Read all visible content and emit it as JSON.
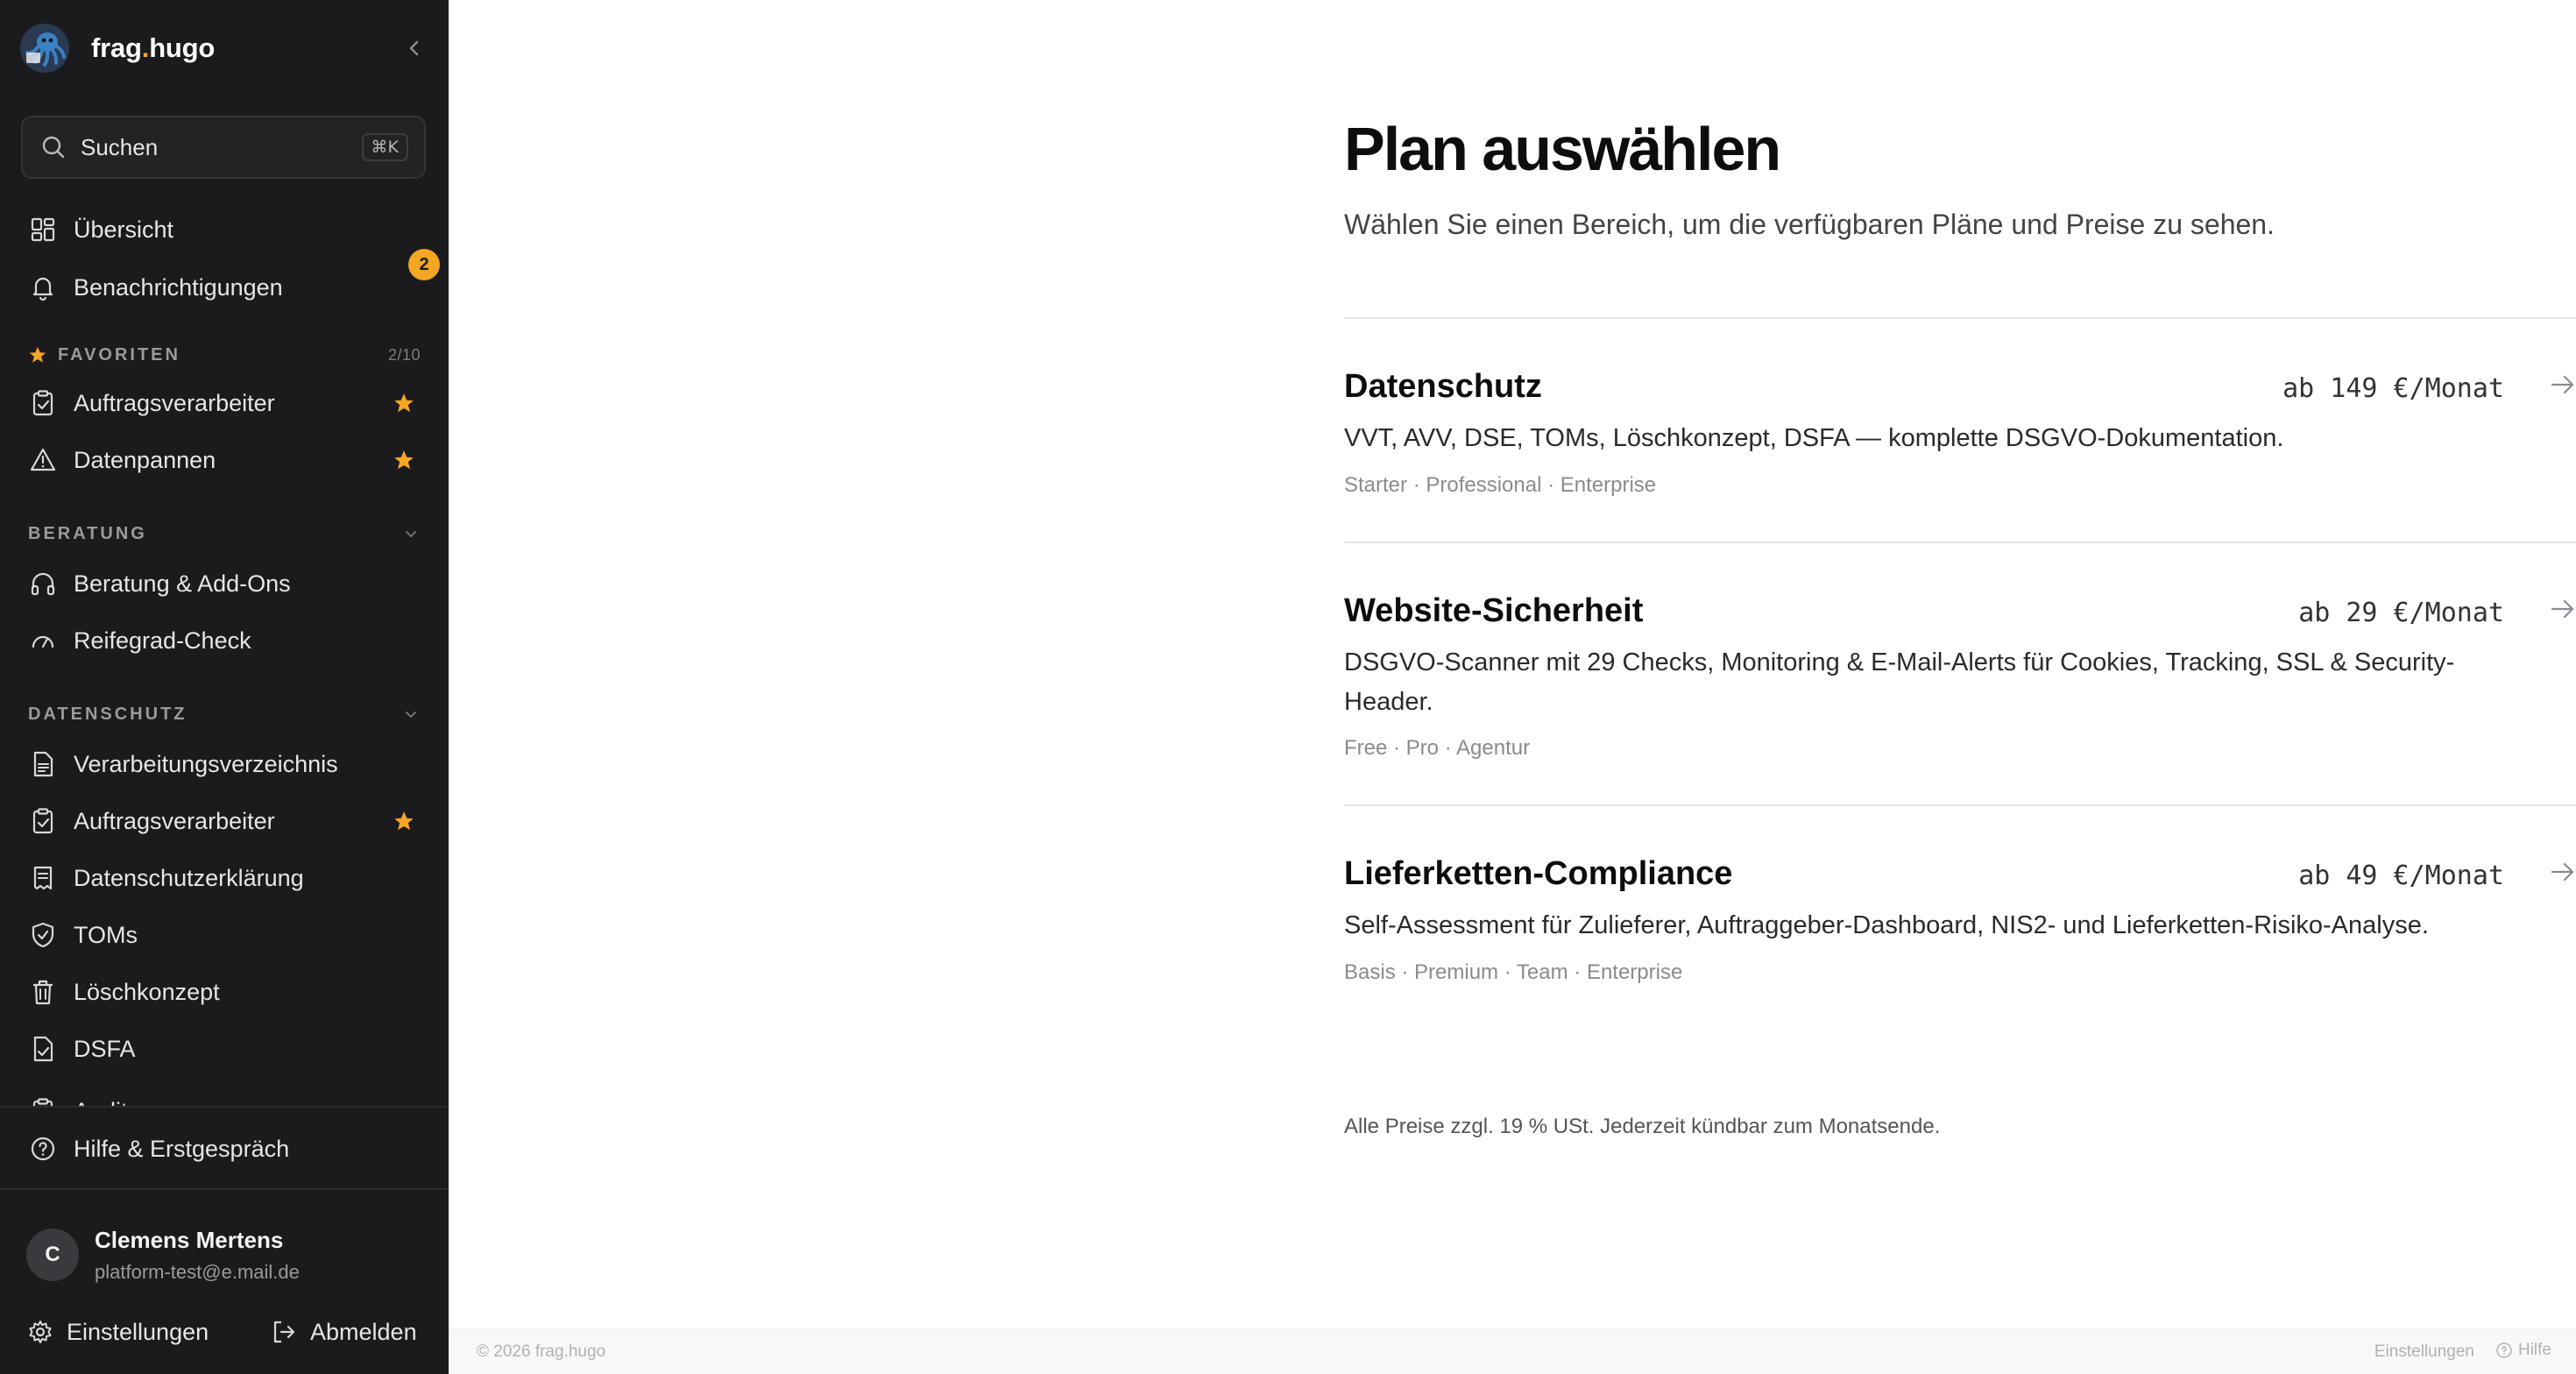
{
  "brand": {
    "name_part1": "frag",
    "name_dot": ".",
    "name_part2": "hugo"
  },
  "search": {
    "placeholder": "Suchen",
    "shortcut": "⌘K"
  },
  "nav_top": [
    {
      "label": "Übersicht",
      "icon": "dashboard-icon"
    },
    {
      "label": "Benachrichtigungen",
      "icon": "bell-icon",
      "badge": "2"
    }
  ],
  "favorites": {
    "title": "FAVORITEN",
    "count": "2/10",
    "items": [
      {
        "label": "Auftragsverarbeiter",
        "icon": "clipboard-check-icon",
        "starred": true
      },
      {
        "label": "Datenpannen",
        "icon": "warning-icon",
        "starred": true
      }
    ]
  },
  "beratung": {
    "title": "BERATUNG",
    "items": [
      {
        "label": "Beratung & Add-Ons",
        "icon": "headphones-icon"
      },
      {
        "label": "Reifegrad-Check",
        "icon": "gauge-icon"
      }
    ]
  },
  "datenschutz": {
    "title": "DATENSCHUTZ",
    "items": [
      {
        "label": "Verarbeitungsverzeichnis",
        "icon": "document-icon"
      },
      {
        "label": "Auftragsverarbeiter",
        "icon": "clipboard-check-icon",
        "starred": true
      },
      {
        "label": "Datenschutzerklärung",
        "icon": "receipt-icon"
      },
      {
        "label": "TOMs",
        "icon": "shield-icon"
      },
      {
        "label": "Löschkonzept",
        "icon": "trash-icon"
      },
      {
        "label": "DSFA",
        "icon": "file-check-icon"
      },
      {
        "label": "Audits",
        "icon": "clipboard-icon"
      }
    ]
  },
  "help": {
    "label": "Hilfe & Erstgespräch",
    "icon": "help-circle-icon"
  },
  "user": {
    "initial": "C",
    "name": "Clemens Mertens",
    "email": "platform-test@e.mail.de"
  },
  "sidebar_footer": {
    "settings": "Einstellungen",
    "logout": "Abmelden"
  },
  "main": {
    "title": "Plan auswählen",
    "subtitle": "Wählen Sie einen Bereich, um die verfügbaren Pläne und Preise zu sehen.",
    "plans": [
      {
        "name": "Datenschutz",
        "price": "ab 149 €/Monat",
        "description": "VVT, AVV, DSE, TOMs, Löschkonzept, DSFA — komplette DSGVO-Dokumentation.",
        "tiers": "Starter · Professional · Enterprise"
      },
      {
        "name": "Website-Sicherheit",
        "price": "ab 29 €/Monat",
        "description": "DSGVO-Scanner mit 29 Checks, Monitoring & E-Mail-Alerts für Cookies, Tracking, SSL & Security-Header.",
        "tiers": "Free · Pro · Agentur"
      },
      {
        "name": "Lieferketten-Compliance",
        "price": "ab 49 €/Monat",
        "description": "Self-Assessment für Zulieferer, Auftraggeber-Dashboard, NIS2- und Lieferketten-Risiko-Analyse.",
        "tiers": "Basis · Premium · Team · Enterprise"
      }
    ],
    "note": "Alle Preise zzgl. 19 % USt. Jederzeit kündbar zum Monatsende."
  },
  "bottom_bar": {
    "copyright": "© 2026 frag.hugo",
    "settings": "Einstellungen",
    "help": "Hilfe"
  },
  "colors": {
    "sidebar_bg": "#1b1b1d",
    "accent": "#f5a623",
    "text_main": "#0d0d0d"
  }
}
